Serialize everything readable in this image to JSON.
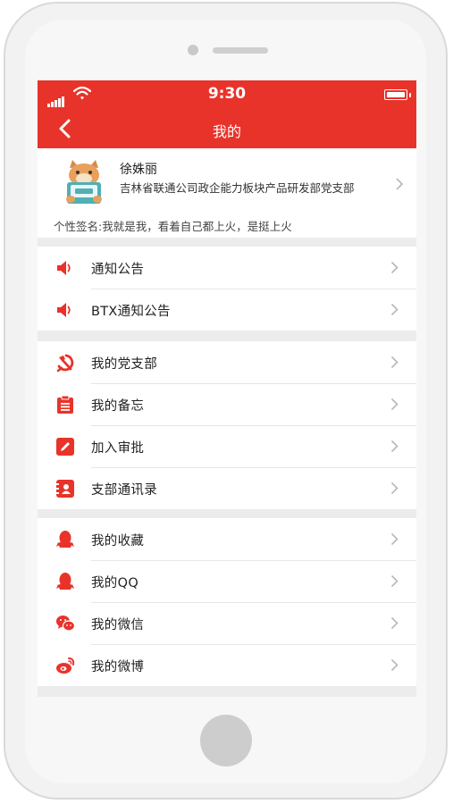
{
  "status_bar": {
    "time": "9:30"
  },
  "nav": {
    "title": "我的"
  },
  "profile": {
    "name": "徐姝丽",
    "org": "吉林省联通公司政企能力板块产品研发部党支部",
    "signature": "个性签名:我就是我，看着自己都上火，是挺上火"
  },
  "sections": [
    {
      "items": [
        {
          "label": "通知公告",
          "icon": "speaker-icon"
        },
        {
          "label": "BTX通知公告",
          "icon": "speaker-icon"
        }
      ]
    },
    {
      "items": [
        {
          "label": "我的党支部",
          "icon": "hammer-sickle-icon"
        },
        {
          "label": "我的备忘",
          "icon": "clipboard-icon"
        },
        {
          "label": "加入审批",
          "icon": "edit-icon"
        },
        {
          "label": "支部通讯录",
          "icon": "contact-card-icon"
        }
      ]
    },
    {
      "items": [
        {
          "label": "我的收藏",
          "icon": "qq-icon"
        },
        {
          "label": "我的QQ",
          "icon": "qq-icon"
        },
        {
          "label": "我的微信",
          "icon": "wechat-icon"
        },
        {
          "label": "我的微博",
          "icon": "weibo-icon"
        }
      ]
    }
  ],
  "colors": {
    "accent": "#e8332a",
    "background": "#ececec",
    "chevron": "#b8b8b8"
  }
}
